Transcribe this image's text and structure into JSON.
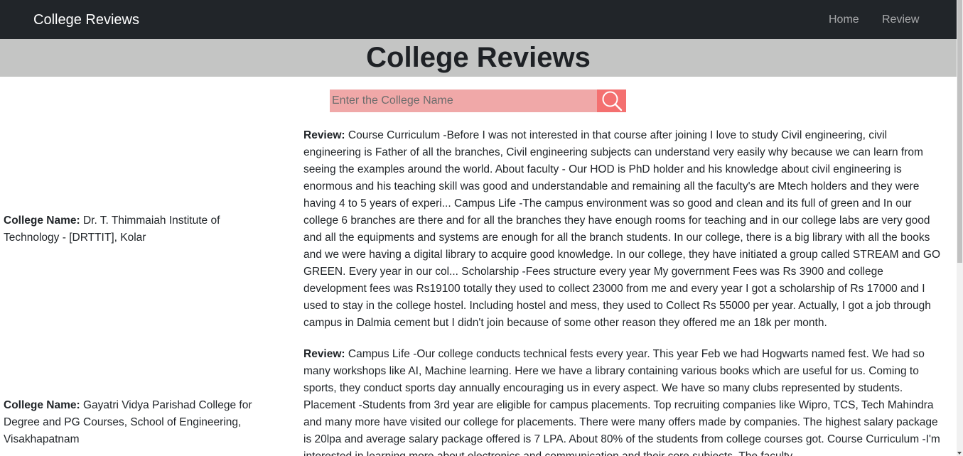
{
  "navbar": {
    "brand": "College Reviews",
    "links": [
      {
        "label": "Home"
      },
      {
        "label": "Review"
      }
    ]
  },
  "header": {
    "title": "College Reviews"
  },
  "search": {
    "placeholder": "Enter the College Name",
    "button_icon": "search-icon"
  },
  "reviews": [
    {
      "name_label": "College Name:",
      "college": " Dr. T. Thimmaiah Institute of Technology - [DRTTIT], Kolar",
      "review_label": "Review:",
      "text": " Course Curriculum -Before I was not interested in that course after joining I love to study Civil engineering, civil engineering is Father of all the branches, Civil engineering subjects can understand very easily why because we can learn from seeing the examples around the world. About faculty - Our HOD is PhD holder and his knowledge about civil engineering is enormous and his teaching skill was good and understandable and remaining all the faculty's are Mtech holders and they were having 4 to 5 years of experi... Campus Life -The campus environment was so good and clean and its full of green and In our college 6 branches are there and for all the branches they have enough rooms for teaching and in our college labs are very good and all the equipments and systems are enough for all the branch students. In our college, there is a big library with all the books and we were having a digital library to acquire good knowledge. In our college, they have initiated a group called STREAM and GO GREEN. Every year in our col... Scholarship -Fees structure every year My government Fees was Rs 3900 and college development fees was Rs19100 totally they used to collect 23000 from me and every year I got a scholarship of Rs 17000 and I used to stay in the college hostel. Including hostel and mess, they used to Collect Rs 55000 per year. Actually, I got a job through campus in Dalmia cement but I didn't join because of some other reason they offered me an 18k per month."
    },
    {
      "name_label": "College Name:",
      "college": " Gayatri Vidya Parishad College for Degree and PG Courses, School of Engineering, Visakhapatnam",
      "review_label": "Review:",
      "text": " Campus Life -Our college conducts technical fests every year. This year Feb we had Hogwarts named fest. We had so many workshops like AI, Machine learning. Here we have a library containing various books which are useful for us. Coming to sports, they conduct sports day annually encouraging us in every aspect. We have so many clubs represented by students. Placement -Students from 3rd year are eligible for campus placements. Top recruiting companies like Wipro, TCS, Tech Mahindra and many more have visited our college for placements. There were many offers made by companies. The highest salary package is 20lpa and average salary package offered is 7 LPA. About 80% of the students from college courses got. Course Curriculum -I'm interested in learning more about electronics and communication and their core subjects. The faculty"
    }
  ],
  "colors": {
    "navbar_bg": "#212529",
    "header_bg": "#c4c5c4",
    "search_input_bg": "#f0a8a8",
    "search_button_bg": "#f47070"
  }
}
